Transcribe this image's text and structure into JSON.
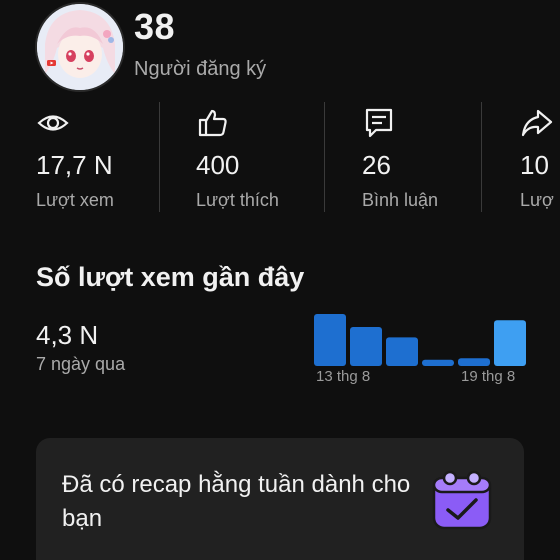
{
  "channel": {
    "subscriber_count": "38",
    "subscriber_label": "Người đăng ký"
  },
  "stats": [
    {
      "icon": "eye-icon",
      "value": "17,7 N",
      "label": "Lượt xem"
    },
    {
      "icon": "thumbs-up-icon",
      "value": "400",
      "label": "Lượt thích"
    },
    {
      "icon": "comment-icon",
      "value": "26",
      "label": "Bình luận"
    },
    {
      "icon": "share-icon",
      "value": "10",
      "label": "Lượ"
    }
  ],
  "recent": {
    "title": "Số lượt xem gần đây",
    "value": "4,3 N",
    "period": "7 ngày qua",
    "chart_data": {
      "type": "bar",
      "categories": [
        "13 thg 8",
        "",
        "",
        "",
        "",
        "19 thg 8"
      ],
      "values": [
        100,
        75,
        55,
        12,
        15,
        88
      ],
      "x_labels_shown": [
        "13 thg 8",
        "19 thg 8"
      ],
      "colors": [
        "#1e6fd0",
        "#1e6fd0",
        "#1e6fd0",
        "#1e6fd0",
        "#1e6fd0",
        "#3e9ff2"
      ]
    }
  },
  "recap_card": {
    "message": "Đã có recap hằng tuần dành cho bạn",
    "icon": "calendar-check-icon",
    "accent": "#8b5cf6"
  }
}
